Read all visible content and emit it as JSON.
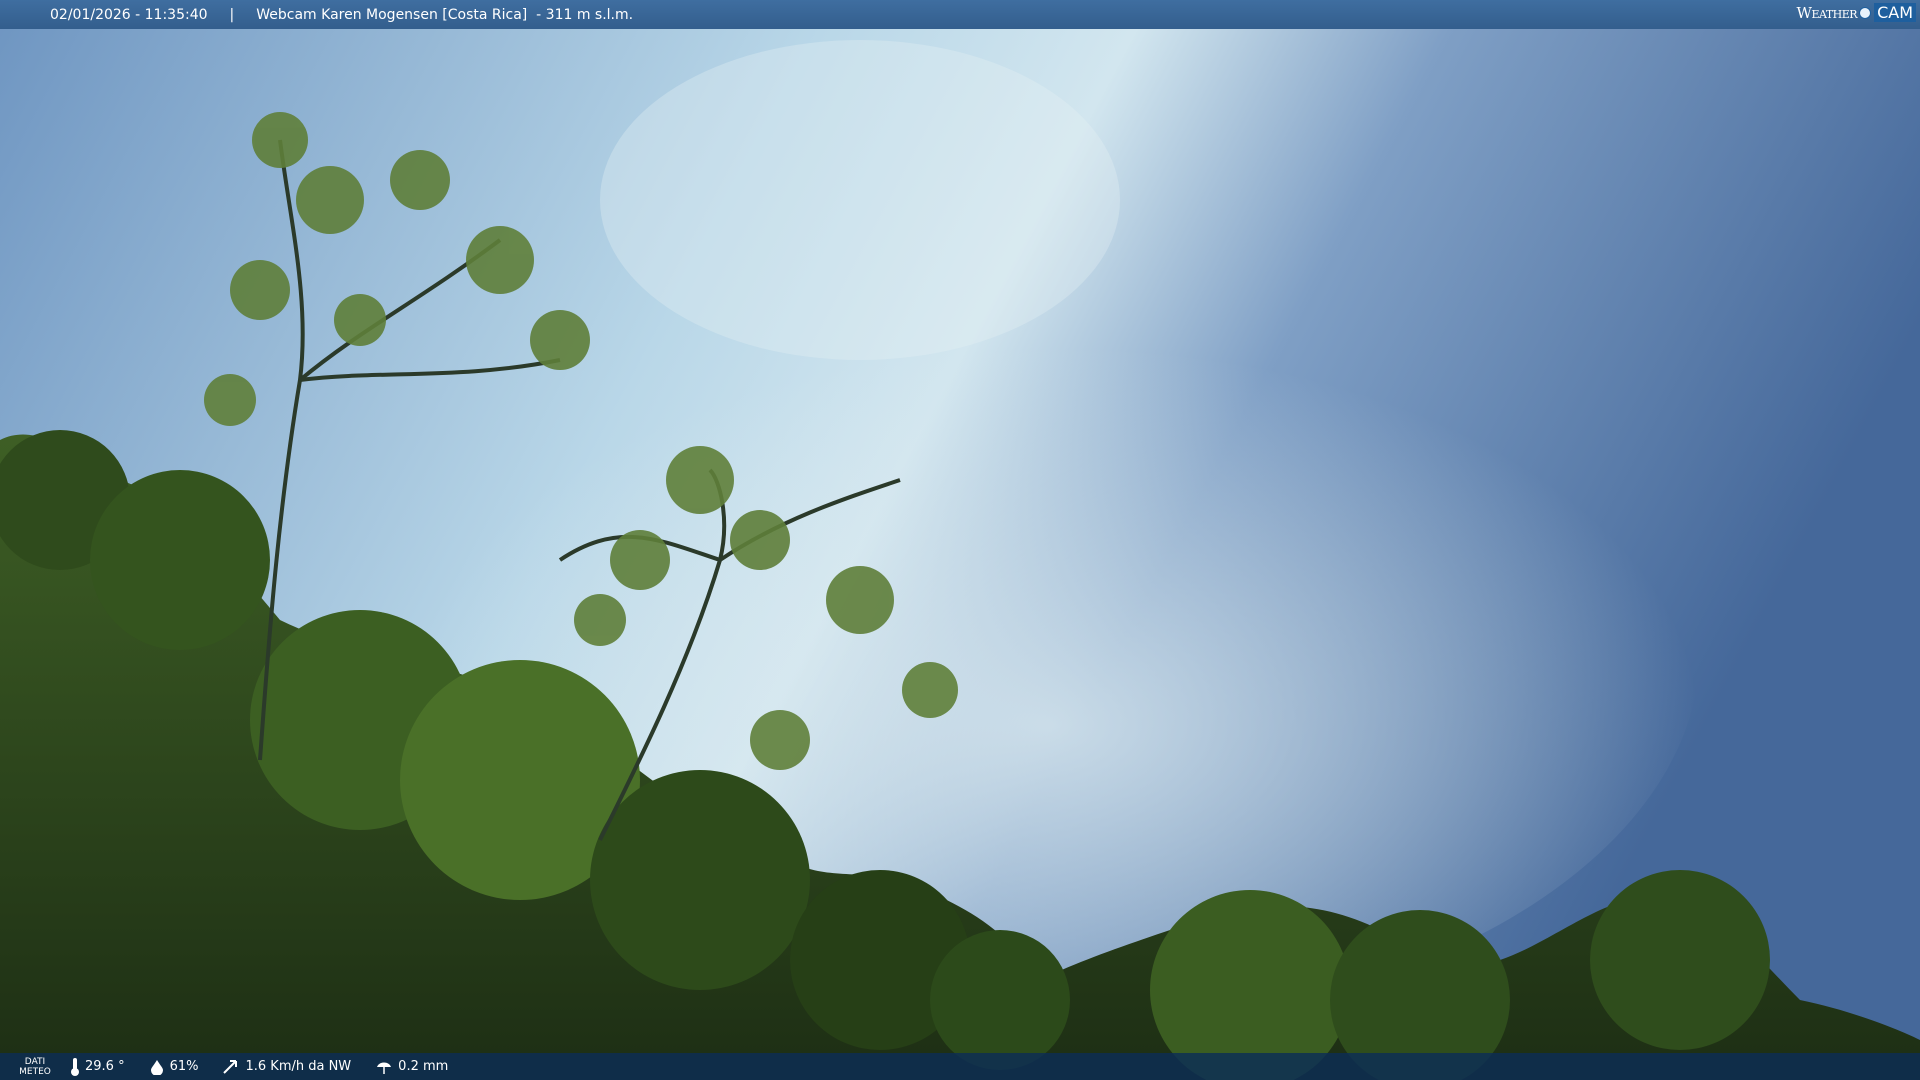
{
  "header": {
    "datetime": "02/01/2026 - 11:35:40",
    "separator": "|",
    "location": "Webcam Karen Mogensen [Costa Rica]  - 311 m s.l.m.",
    "logo_word1": "Weather",
    "logo_word2": "CAM"
  },
  "footer": {
    "label_line1": "DATI",
    "label_line2": "METEO",
    "temperature": "29.6 °",
    "humidity": "61%",
    "wind": "1.6 Km/h da NW",
    "rain": "0.2 mm"
  },
  "icons": [
    "thermometer-icon",
    "humidity-drop-icon",
    "wind-icon",
    "rain-icon"
  ],
  "colors": {
    "bar_top": "#3a6797",
    "bar_bottom": "#0c2d55",
    "sky_light": "#d6ebf3",
    "sky_deep": "#3f6392",
    "foliage": "#2f4a1c"
  }
}
